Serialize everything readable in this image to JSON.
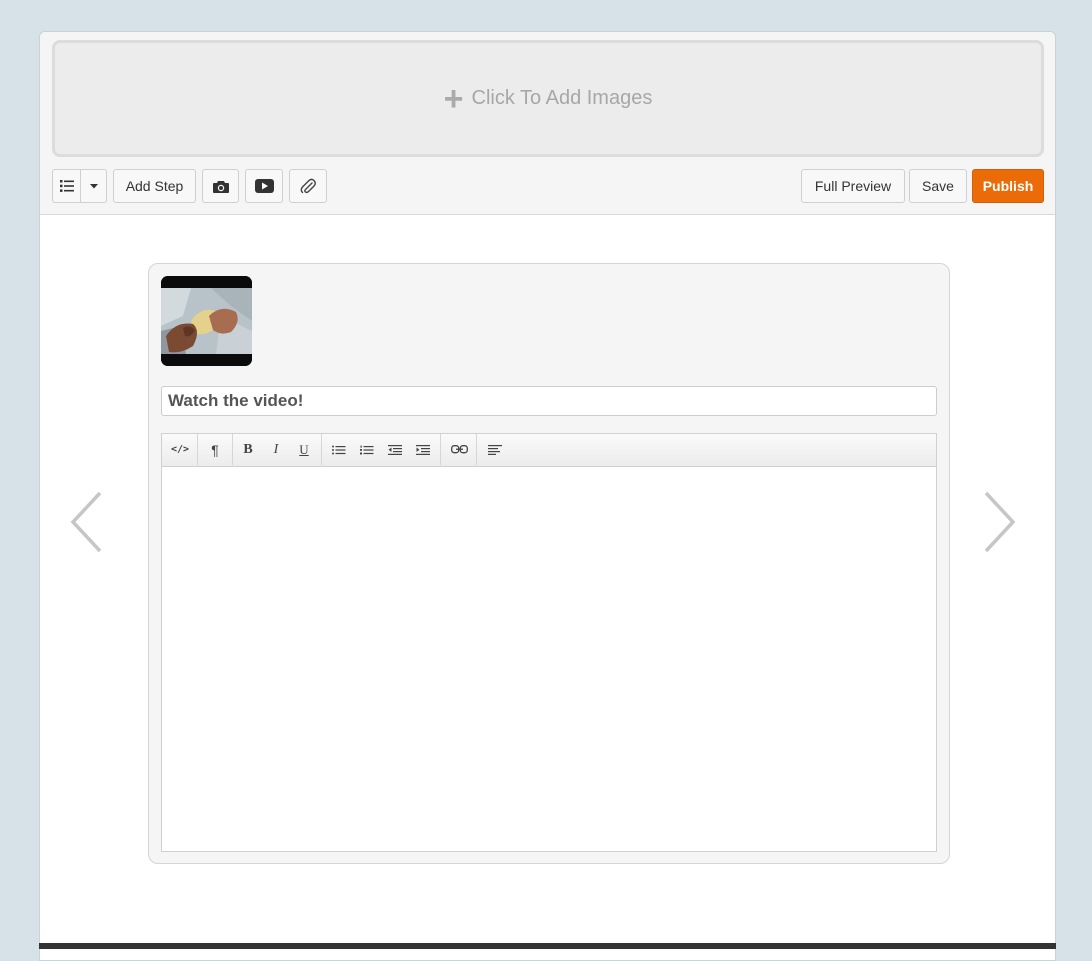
{
  "dropzone": {
    "plus": "+",
    "label": "Click To Add Images"
  },
  "toolbar": {
    "list_icon": "list-icon",
    "dropdown_icon": "caret-down-icon",
    "add_step_label": "Add Step",
    "camera_icon": "camera-icon",
    "video_icon": "youtube-icon",
    "attach_icon": "paperclip-icon",
    "full_preview_label": "Full Preview",
    "save_label": "Save",
    "publish_label": "Publish",
    "publish_color": "#ea6b07"
  },
  "step": {
    "title_value": "Watch the video!",
    "editor": {
      "buttons": [
        "html-icon",
        "paragraph-icon",
        "bold-icon",
        "italic-icon",
        "underline-icon",
        "unordered-list-icon",
        "ordered-list-icon",
        "outdent-icon",
        "indent-icon",
        "link-icon",
        "align-icon"
      ],
      "html_glyph": "</>",
      "paragraph_glyph": "¶",
      "bold_glyph": "B",
      "italic_glyph": "I",
      "underline_glyph": "U"
    }
  },
  "navigation": {
    "prev_icon": "chevron-left-icon",
    "next_icon": "chevron-right-icon"
  }
}
